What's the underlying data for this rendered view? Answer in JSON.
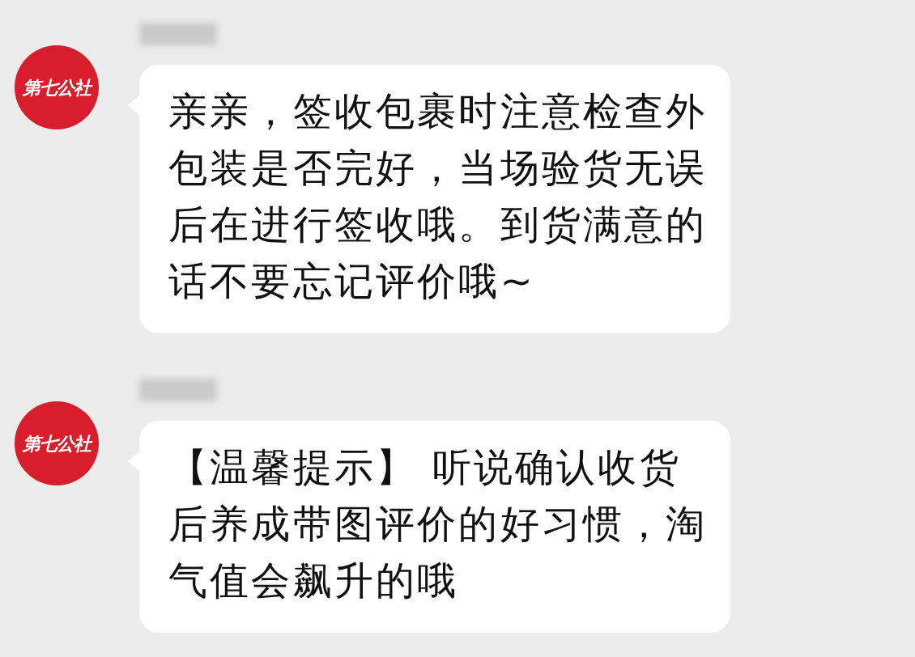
{
  "messages": [
    {
      "avatar": {
        "text": "第七公社"
      },
      "text": "亲亲，签收包裹时注意检查外包装是否完好，当场验货无误后在进行签收哦。到货满意的话不要忘记评价哦~"
    },
    {
      "avatar": {
        "text": "第七公社"
      },
      "text": "【温馨提示】 听说确认收货后养成带图评价的好习惯，淘气值会飙升的哦"
    }
  ]
}
